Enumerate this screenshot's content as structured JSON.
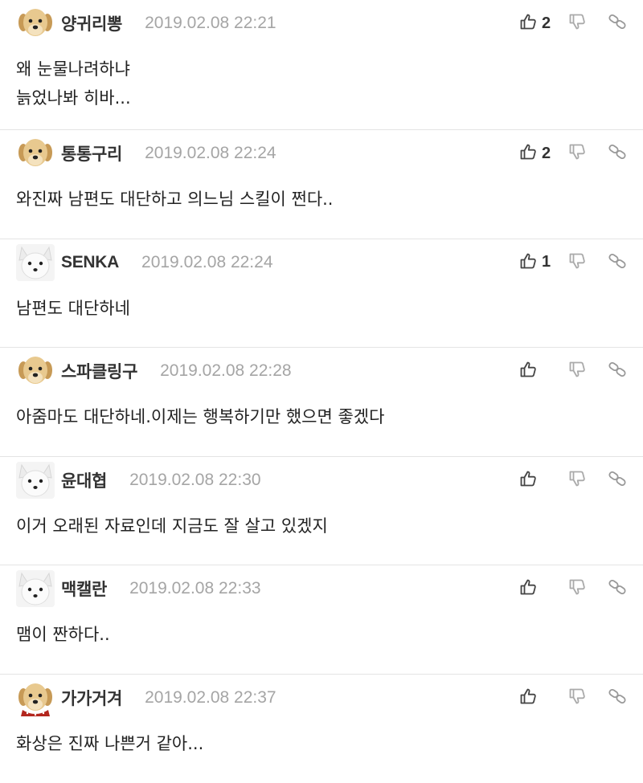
{
  "comments": [
    {
      "nickname": "양귀리뽕",
      "timestamp": "2019.02.08 22:21",
      "likes": "2",
      "text": "왜 눈물나려하냐\n늙었나봐 히바...",
      "avatar": "puppy-avatar"
    },
    {
      "nickname": "통통구리",
      "timestamp": "2019.02.08 22:24",
      "likes": "2",
      "text": "와진짜 남편도 대단하고 의느님 스킬이 쩐다..",
      "avatar": "puppy-avatar"
    },
    {
      "nickname": "SENKA",
      "timestamp": "2019.02.08 22:24",
      "likes": "1",
      "text": "남편도 대단하네",
      "avatar": "white-fox-avatar"
    },
    {
      "nickname": "스파클링구",
      "timestamp": "2019.02.08 22:28",
      "likes": "",
      "text": "아줌마도 대단하네.이제는 행복하기만 했으면 좋겠다",
      "avatar": "puppy-avatar"
    },
    {
      "nickname": "윤대협",
      "timestamp": "2019.02.08 22:30",
      "likes": "",
      "text": "이거 오래된 자료인데 지금도 잘 살고 있겠지",
      "avatar": "white-fox-avatar"
    },
    {
      "nickname": "맥캘란",
      "timestamp": "2019.02.08 22:33",
      "likes": "",
      "text": "맴이 짠하다..",
      "avatar": "white-fox-avatar"
    },
    {
      "nickname": "가가거겨",
      "timestamp": "2019.02.08 22:37",
      "likes": "",
      "text": "화상은 진짜 나쁜거 같아...",
      "avatar": "puppy-scarf-avatar"
    }
  ],
  "icons": {
    "like": "thumbs-up-icon",
    "dislike": "thumbs-down-icon",
    "share": "link-icon"
  },
  "colors": {
    "text": "#222222",
    "timestamp": "#a5a5a5",
    "divider": "#e4e4e4",
    "icon": "#444444"
  }
}
